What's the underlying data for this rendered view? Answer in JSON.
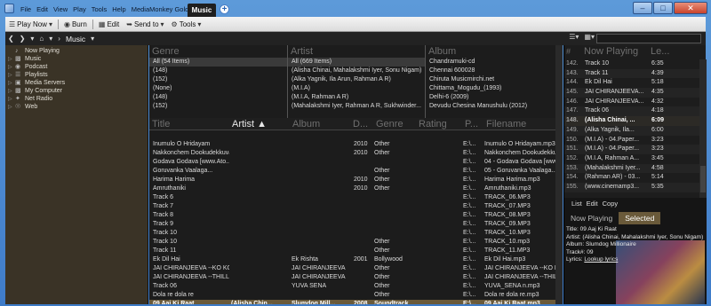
{
  "menu": [
    "File",
    "Edit",
    "View",
    "Play",
    "Tools",
    "Help",
    "MediaMonkey Gold"
  ],
  "active_tab": "Music",
  "toolbar": {
    "play_now": "Play Now",
    "burn": "Burn",
    "edit": "Edit",
    "send_to": "Send to",
    "tools": "Tools"
  },
  "nav": {
    "crumb": "Music"
  },
  "tree": [
    {
      "label": "Now Playing",
      "icon": "now-playing-icon"
    },
    {
      "label": "Music",
      "icon": "music-icon"
    },
    {
      "label": "Podcast",
      "icon": "podcast-icon"
    },
    {
      "label": "Playlists",
      "icon": "playlists-icon"
    },
    {
      "label": "Media Servers",
      "icon": "media-servers-icon"
    },
    {
      "label": "My Computer",
      "icon": "computer-icon"
    },
    {
      "label": "Net Radio",
      "icon": "radio-icon"
    },
    {
      "label": "Web",
      "icon": "web-icon"
    }
  ],
  "browser": {
    "genre": {
      "header": "Genre",
      "items": [
        "All (54 Items)",
        "(148)",
        "(152)",
        "(None)",
        "(148)",
        "(152)"
      ]
    },
    "artist": {
      "header": "Artist",
      "items": [
        "All (669 Items)",
        "(Alisha Chinai, Mahalakshmi Iyer, Sonu Nigam)",
        "(Alka Yagnik, Ila Arun, Rahman A R)",
        "(M.I.A)",
        "(M.I.A, Rahman A R)",
        "(Mahalakshmi Iyer, Rahman A R, Sukhwinder..."
      ]
    },
    "album": {
      "header": "Album",
      "items": [
        "Chandramuki-cd",
        "Chennai 600028",
        "Chiruta  Musicmirchi.net",
        "Chittama_Mogudu_(1993)",
        "Delhi-6 (2009)",
        "Devudu Chesina Manushulu (2012)"
      ]
    }
  },
  "tracks_header": {
    "title": "Title",
    "artist": "Artist",
    "album": "Album",
    "date": "D...",
    "genre": "Genre",
    "rating": "Rating",
    "path": "P...",
    "filename": "Filename"
  },
  "tracks": [
    {
      "title": "",
      "artist": "",
      "album": "",
      "date": "",
      "genre": "",
      "path": "",
      "filename": ""
    },
    {
      "title": "Inumulo O Hridayam",
      "artist": "",
      "album": "",
      "date": "2010",
      "genre": "Other",
      "path": "E:\\...",
      "filename": "Inumulo O Hridayam.mp3"
    },
    {
      "title": "Nakkonchem Dookudekkuva",
      "artist": "",
      "album": "",
      "date": "2010",
      "genre": "Other",
      "path": "E:\\...",
      "filename": "Nakkonchem Dookudekkuva"
    },
    {
      "title": "Godava Godava [www.Ato...",
      "artist": "",
      "album": "",
      "date": "",
      "genre": "",
      "path": "E:\\...",
      "filename": "04 - Godava Godava [www..."
    },
    {
      "title": "Goruvanka Vaalaga...",
      "artist": "",
      "album": "",
      "date": "",
      "genre": "Other",
      "path": "E:\\...",
      "filename": "05 - Goruvanka Vaalaga..."
    },
    {
      "title": "Harima Harima",
      "artist": "",
      "album": "",
      "date": "2010",
      "genre": "Other",
      "path": "E:\\...",
      "filename": "Harima Harima.mp3"
    },
    {
      "title": "Amruthaniki",
      "artist": "",
      "album": "",
      "date": "2010",
      "genre": "Other",
      "path": "E:\\...",
      "filename": "Amruthaniki.mp3"
    },
    {
      "title": "Track 6",
      "artist": "",
      "album": "",
      "date": "",
      "genre": "",
      "path": "E:\\...",
      "filename": "TRACK_06.MP3"
    },
    {
      "title": "Track 7",
      "artist": "",
      "album": "",
      "date": "",
      "genre": "",
      "path": "E:\\...",
      "filename": "TRACK_07.MP3"
    },
    {
      "title": "Track 8",
      "artist": "",
      "album": "",
      "date": "",
      "genre": "",
      "path": "E:\\...",
      "filename": "TRACK_08.MP3"
    },
    {
      "title": "Track 9",
      "artist": "",
      "album": "",
      "date": "",
      "genre": "",
      "path": "E:\\...",
      "filename": "TRACK_09.MP3"
    },
    {
      "title": "Track 10",
      "artist": "",
      "album": "",
      "date": "",
      "genre": "",
      "path": "E:\\...",
      "filename": "TRACK_10.MP3"
    },
    {
      "title": "Track 10",
      "artist": "",
      "album": "",
      "date": "",
      "genre": "Other",
      "path": "E:\\...",
      "filename": "TRACK_10.mp3"
    },
    {
      "title": "Track 11",
      "artist": "",
      "album": "",
      "date": "",
      "genre": "Other",
      "path": "E:\\...",
      "filename": "TRACK_11.MP3"
    },
    {
      "title": "Ek Dil Hai",
      "artist": "",
      "album": "Ek Rishta",
      "date": "2001",
      "genre": "Bollywood",
      "path": "E:\\...",
      "filename": "Ek Dil Hai.mp3"
    },
    {
      "title": "JAI CHIRANJEEVA --KO KO...",
      "artist": "",
      "album": "JAI CHIRANJEEVA",
      "date": "",
      "genre": "Other",
      "path": "E:\\...",
      "filename": "JAI CHIRANJEEVA --KO K..."
    },
    {
      "title": "JAI CHIRANJEEVA --THILL...",
      "artist": "",
      "album": "JAI CHIRANJEEVA",
      "date": "",
      "genre": "Other",
      "path": "E:\\...",
      "filename": "JAI CHIRANJEEVA --THILL..."
    },
    {
      "title": "Track 06",
      "artist": "",
      "album": "YUVA SENA",
      "date": "",
      "genre": "Other",
      "path": "E:\\...",
      "filename": "YUVA_SENA n.mp3"
    },
    {
      "title": "Dola re dola re",
      "artist": "",
      "album": "",
      "date": "",
      "genre": "Other",
      "path": "E:\\...",
      "filename": "Dola re dola re.mp3"
    },
    {
      "title": "09 Aaj Ki Raat",
      "artist": "(Alisha Chin...",
      "album": "Slumdog Mill...",
      "date": "2008",
      "genre": "Soundtrack",
      "path": "E:\\...",
      "filename": "09 Aaj Ki Raat.mp3",
      "playing": true
    }
  ],
  "now_playing": {
    "header_num": "#",
    "header_title": "Now Playing",
    "header_len": "Le...",
    "rows": [
      {
        "n": "142.",
        "t": "Track 10",
        "l": "6:35"
      },
      {
        "n": "143.",
        "t": "Track 11",
        "l": "4:39"
      },
      {
        "n": "144.",
        "t": "Ek Dil Hai",
        "l": "5:18"
      },
      {
        "n": "145.",
        "t": "JAI CHIRANJEEVA...",
        "l": "4:35"
      },
      {
        "n": "146.",
        "t": "JAI CHIRANJEEVA...",
        "l": "4:32"
      },
      {
        "n": "147.",
        "t": "Track 06",
        "l": "4:18"
      },
      {
        "n": "148.",
        "t": "(Alisha Chinai, ...",
        "l": "6:09",
        "cur": true
      },
      {
        "n": "149.",
        "t": "(Alka Yagnik, Ila...",
        "l": "6:00"
      },
      {
        "n": "150.",
        "t": "(M.I.A) - 04.Paper...",
        "l": "3:23"
      },
      {
        "n": "151.",
        "t": "(M.I.A) - 04.Paper...",
        "l": "3:23"
      },
      {
        "n": "152.",
        "t": "(M.I.A, Rahman A...",
        "l": "3:45"
      },
      {
        "n": "153.",
        "t": "(Mahalakshmi Iyer...",
        "l": "4:58"
      },
      {
        "n": "154.",
        "t": "(Rahman AR) - 03...",
        "l": "5:14"
      },
      {
        "n": "155.",
        "t": "(www.cinemamp3...",
        "l": "5:35"
      }
    ]
  },
  "info": {
    "menu": [
      "List",
      "Edit",
      "Copy"
    ],
    "tabs": [
      "Now Playing",
      "Selected"
    ],
    "title": "Title: 09 Aaj Ki Raat",
    "artist": "Artist: (Alisha Chinai, Mahalakshmi Iyer, Sonu Nigam)",
    "album": "Album: Slumdog Millionaire",
    "track": "Track#: 09",
    "lyrics_label": "Lyrics:",
    "lyrics_link": "Lookup lyrics"
  },
  "colors": {
    "playing_row": "#6a5a3a",
    "tree_bg": "#3a3326",
    "window_frame": "#3d7bc7"
  }
}
